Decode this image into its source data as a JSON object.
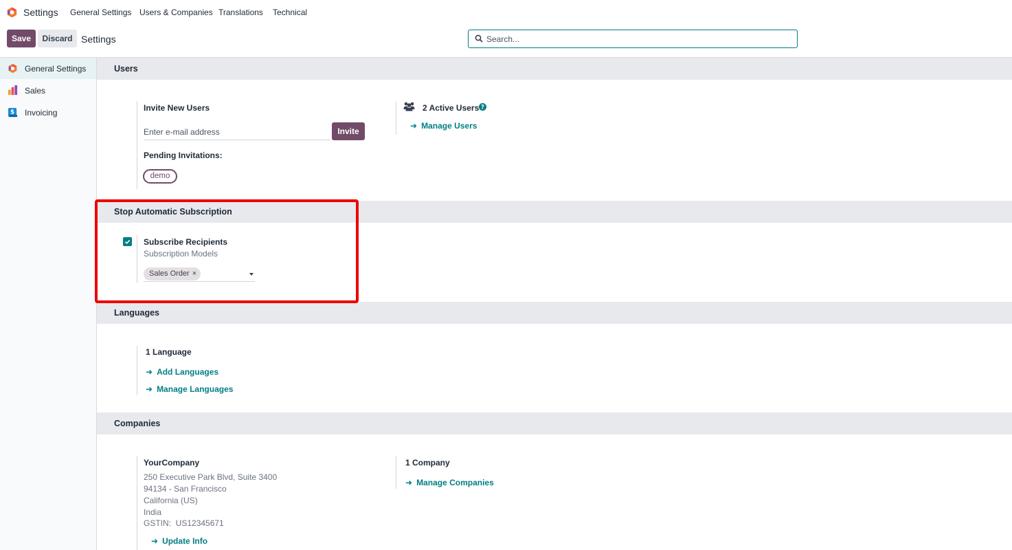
{
  "topnav": {
    "app_title": "Settings",
    "menu": [
      "General Settings",
      "Users & Companies",
      "Translations",
      "Technical"
    ]
  },
  "controlbar": {
    "save_label": "Save",
    "discard_label": "Discard",
    "breadcrumb": "Settings",
    "search_placeholder": "Search..."
  },
  "sidebar": {
    "items": [
      {
        "label": "General Settings",
        "icon": "settings-app-icon",
        "active": true
      },
      {
        "label": "Sales",
        "icon": "sales-app-icon",
        "active": false
      },
      {
        "label": "Invoicing",
        "icon": "invoicing-app-icon",
        "active": false
      }
    ]
  },
  "users": {
    "title": "Users",
    "invite_label": "Invite New Users",
    "email_placeholder": "Enter e-mail address",
    "invite_button": "Invite",
    "pending_label": "Pending Invitations:",
    "pending": [
      "demo"
    ],
    "active_users": "2 Active Users",
    "manage_users": "Manage Users"
  },
  "subscription": {
    "title": "Stop Automatic Subscription",
    "subscribe_label": "Subscribe Recipients",
    "models_label": "Subscription Models",
    "checked": true,
    "tags": [
      "Sales Order"
    ]
  },
  "languages": {
    "title": "Languages",
    "count": "1 Language",
    "add": "Add Languages",
    "manage": "Manage Languages"
  },
  "companies": {
    "title": "Companies",
    "company_name": "YourCompany",
    "address": [
      "250 Executive Park Blvd, Suite 3400",
      "94134 - San Francisco",
      "California (US)",
      "India",
      "GSTIN:  US12345671"
    ],
    "update_info": "Update Info",
    "count": "1 Company",
    "manage": "Manage Companies"
  },
  "colors": {
    "brand": "#714B67",
    "link": "#017e84",
    "highlight": "#ee0000"
  }
}
